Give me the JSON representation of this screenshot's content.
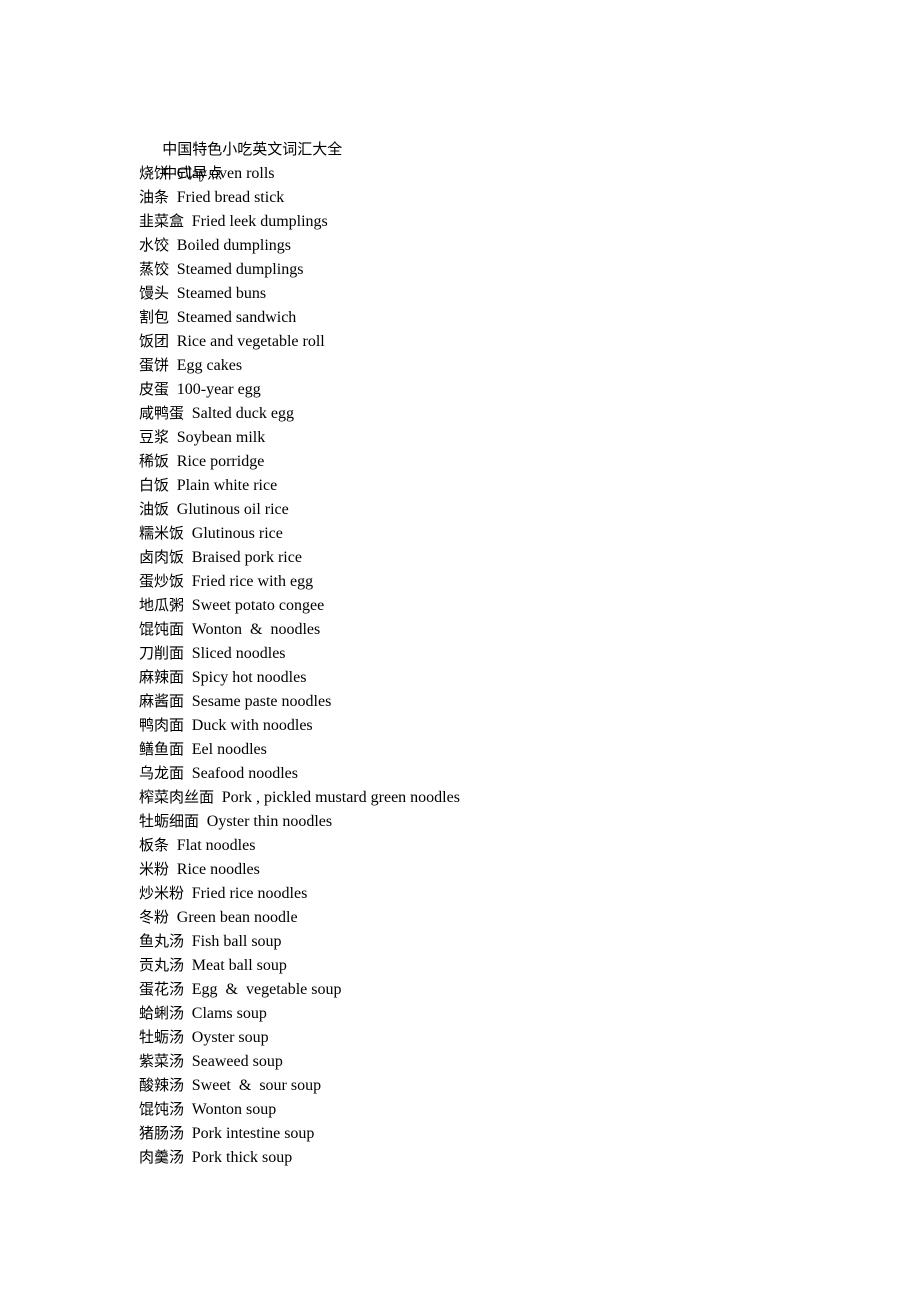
{
  "document": {
    "title": "中国特色小吃英文词汇大全",
    "section_heading": "中式早点",
    "text_color": "#000000",
    "background_color": "#ffffff"
  },
  "entries": [
    {
      "zh": "烧饼",
      "en": "Clay oven rolls"
    },
    {
      "zh": "油条",
      "en": "Fried bread stick"
    },
    {
      "zh": "韭菜盒",
      "en": "Fried leek dumplings"
    },
    {
      "zh": "水饺",
      "en": "Boiled dumplings"
    },
    {
      "zh": "蒸饺",
      "en": "Steamed dumplings"
    },
    {
      "zh": "馒头",
      "en": "Steamed buns"
    },
    {
      "zh": "割包",
      "en": "Steamed sandwich"
    },
    {
      "zh": "饭团",
      "en": "Rice and vegetable roll"
    },
    {
      "zh": "蛋饼",
      "en": "Egg cakes"
    },
    {
      "zh": "皮蛋",
      "en": "100-year egg"
    },
    {
      "zh": "咸鸭蛋",
      "en": "Salted duck egg"
    },
    {
      "zh": "豆浆",
      "en": "Soybean milk"
    },
    {
      "zh": "稀饭",
      "en": "Rice porridge"
    },
    {
      "zh": "白饭",
      "en": "Plain white rice"
    },
    {
      "zh": "油饭",
      "en": "Glutinous oil rice"
    },
    {
      "zh": "糯米饭",
      "en": "Glutinous rice"
    },
    {
      "zh": "卤肉饭",
      "en": "Braised pork rice"
    },
    {
      "zh": "蛋炒饭",
      "en": "Fried rice with egg"
    },
    {
      "zh": "地瓜粥",
      "en": "Sweet potato congee"
    },
    {
      "zh": "馄饨面",
      "en": "Wonton  &  noodles"
    },
    {
      "zh": "刀削面",
      "en": "Sliced noodles"
    },
    {
      "zh": "麻辣面",
      "en": "Spicy hot noodles"
    },
    {
      "zh": "麻酱面",
      "en": "Sesame paste noodles"
    },
    {
      "zh": "鸭肉面",
      "en": "Duck with noodles"
    },
    {
      "zh": "鳝鱼面",
      "en": "Eel noodles"
    },
    {
      "zh": "乌龙面",
      "en": "Seafood noodles"
    },
    {
      "zh": "榨菜肉丝面",
      "en": "Pork , pickled mustard green noodles"
    },
    {
      "zh": "牡蛎细面",
      "en": "Oyster thin noodles"
    },
    {
      "zh": "板条",
      "en": "Flat noodles"
    },
    {
      "zh": "米粉",
      "en": "Rice noodles"
    },
    {
      "zh": "炒米粉",
      "en": "Fried rice noodles"
    },
    {
      "zh": "冬粉",
      "en": "Green bean noodle"
    },
    {
      "zh": "鱼丸汤",
      "en": "Fish ball soup"
    },
    {
      "zh": "贡丸汤",
      "en": "Meat ball soup"
    },
    {
      "zh": "蛋花汤",
      "en": "Egg  &  vegetable soup"
    },
    {
      "zh": "蛤蜊汤",
      "en": "Clams soup"
    },
    {
      "zh": "牡蛎汤",
      "en": "Oyster soup"
    },
    {
      "zh": "紫菜汤",
      "en": "Seaweed soup"
    },
    {
      "zh": "酸辣汤",
      "en": "Sweet  &  sour soup"
    },
    {
      "zh": "馄饨汤",
      "en": "Wonton soup"
    },
    {
      "zh": "猪肠汤",
      "en": "Pork intestine soup"
    },
    {
      "zh": "肉羹汤",
      "en": "Pork thick soup"
    }
  ]
}
